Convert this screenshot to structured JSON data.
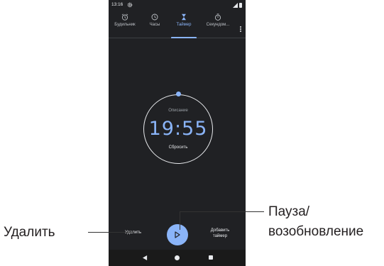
{
  "status_bar": {
    "time": "13:16"
  },
  "tabs": [
    {
      "label": "Будильник",
      "icon": "alarm-icon",
      "active": false
    },
    {
      "label": "Часы",
      "icon": "clock-icon",
      "active": false
    },
    {
      "label": "Таймер",
      "icon": "hourglass-icon",
      "active": true
    },
    {
      "label": "Секундом...",
      "icon": "stopwatch-icon",
      "active": false
    }
  ],
  "timer": {
    "label": "Описание",
    "value": "19:55",
    "reset_label": "Сбросить"
  },
  "actions": {
    "delete_label": "Удалить",
    "add_label_line1": "Добавить",
    "add_label_line2": "таймер"
  },
  "callouts": {
    "delete": "Удалить",
    "pause_line1": "Пауза/",
    "pause_line2": "возобновление"
  },
  "colors": {
    "background": "#202124",
    "accent": "#8ab4f8",
    "text": "#e8eaed"
  }
}
